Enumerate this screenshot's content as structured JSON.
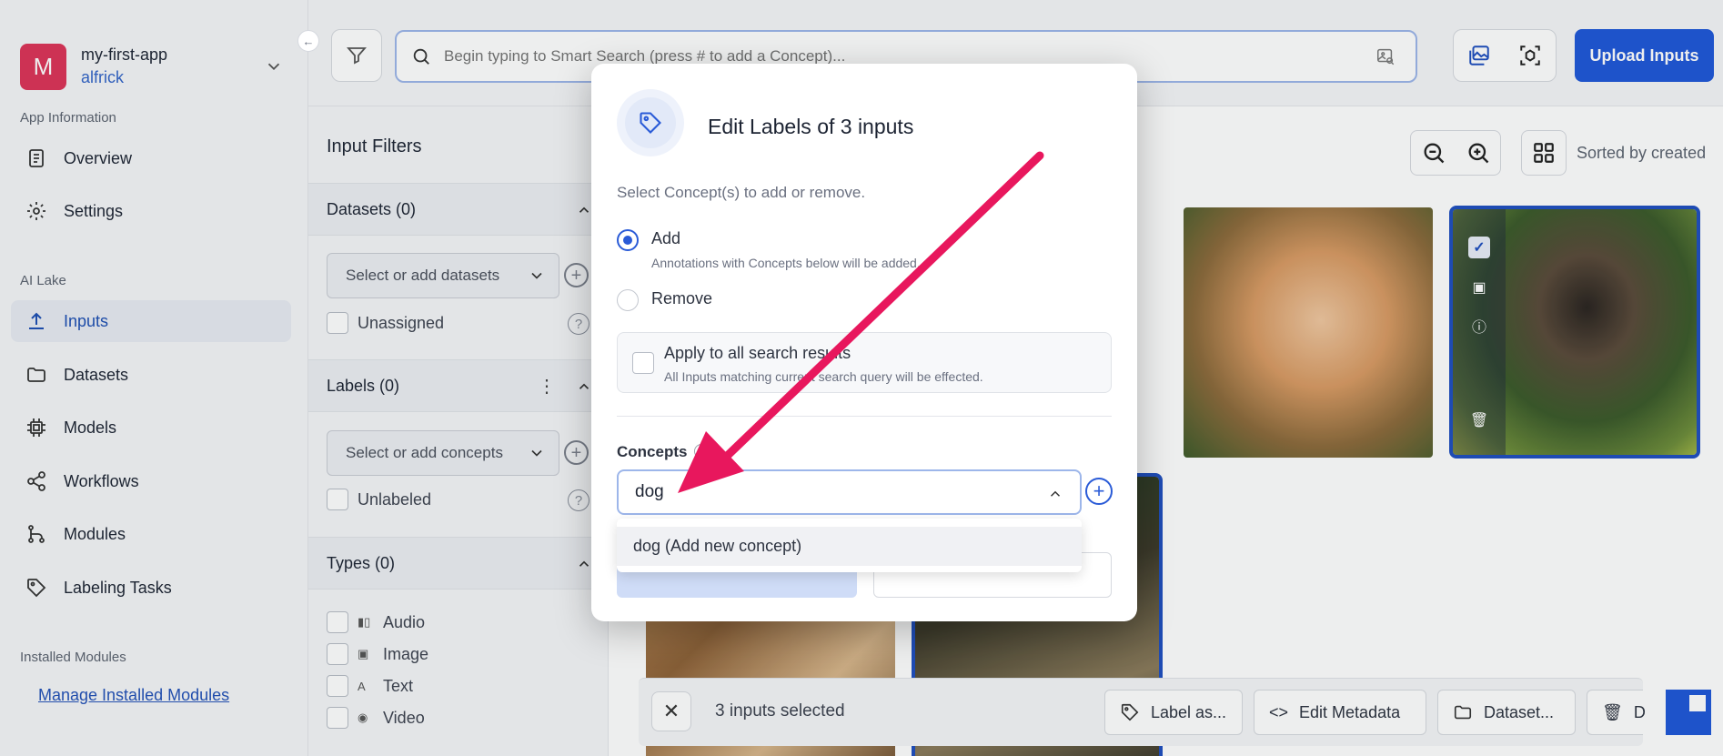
{
  "app": {
    "avatar_letter": "M",
    "name": "my-first-app",
    "user": "alfrick"
  },
  "sidebar": {
    "section_app": "App Information",
    "items_app": [
      {
        "label": "Overview",
        "icon": "document-icon"
      },
      {
        "label": "Settings",
        "icon": "gear-icon"
      }
    ],
    "section_lake": "AI Lake",
    "items_lake": [
      {
        "label": "Inputs",
        "icon": "upload-icon",
        "active": true
      },
      {
        "label": "Datasets",
        "icon": "folder-icon"
      },
      {
        "label": "Models",
        "icon": "chip-icon"
      },
      {
        "label": "Workflows",
        "icon": "share-icon"
      },
      {
        "label": "Modules",
        "icon": "branch-icon"
      },
      {
        "label": "Labeling Tasks",
        "icon": "tag-icon"
      }
    ],
    "section_modules": "Installed Modules",
    "manage_link": "Manage Installed Modules"
  },
  "topbar": {
    "search_placeholder": "Begin typing to Smart Search (press # to add a Concept)...",
    "upload_label": "Upload Inputs"
  },
  "filters": {
    "title": "Input Filters",
    "datasets_head": "Datasets (0)",
    "datasets_select": "Select or add datasets",
    "unassigned": "Unassigned",
    "labels_head": "Labels (0)",
    "concepts_select": "Select or add concepts",
    "unlabeled": "Unlabeled",
    "types_head": "Types (0)",
    "types": [
      "Audio",
      "Image",
      "Text",
      "Video"
    ]
  },
  "gallery": {
    "sorted_label": "Sorted by created"
  },
  "selection_bar": {
    "count_label": "3 inputs selected",
    "label_btn": "Label as...",
    "metadata_btn": "Edit Metadata",
    "dataset_btn": "Dataset...",
    "delete_btn": "D"
  },
  "modal": {
    "title": "Edit Labels of 3 inputs",
    "subtitle": "Select Concept(s) to add or remove.",
    "add_label": "Add",
    "add_desc": "Annotations with Concepts below will be added.",
    "remove_label": "Remove",
    "apply_title": "Apply to all search results",
    "apply_desc": "All Inputs matching current search query will be effected.",
    "concepts_label": "Concepts",
    "concept_value": "dog",
    "dropdown_option": "dog (Add new concept)"
  },
  "colors": {
    "primary": "#1f57d8",
    "accent_arrow": "#e8175d",
    "avatar": "#dd3458"
  }
}
